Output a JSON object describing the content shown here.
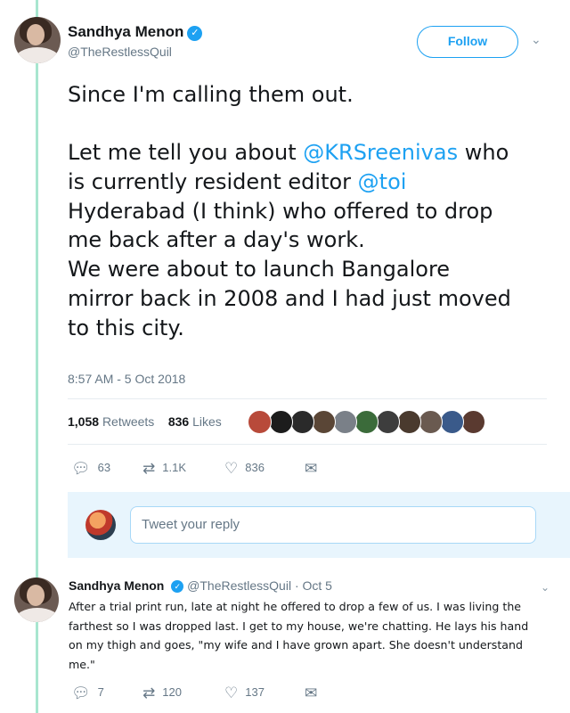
{
  "tweet": {
    "author_name": "Sandhya Menon",
    "author_handle": "@TheRestlessQuil",
    "follow_label": "Follow",
    "text_lines": [
      [
        {
          "t": "Since I'm calling them out.",
          "m": false
        }
      ],
      [
        {
          "t": "",
          "m": false
        }
      ],
      [
        {
          "t": "Let me tell you about ",
          "m": false
        },
        {
          "t": "@KRSreenivas",
          "m": true
        },
        {
          "t": " who",
          "m": false
        }
      ],
      [
        {
          "t": "is currently resident editor ",
          "m": false
        },
        {
          "t": "@toi",
          "m": true
        }
      ],
      [
        {
          "t": "Hyderabad (I think) who offered to drop",
          "m": false
        }
      ],
      [
        {
          "t": "me back after a day's work.",
          "m": false
        }
      ],
      [
        {
          "t": "We were about to launch Bangalore",
          "m": false
        }
      ],
      [
        {
          "t": "mirror back in 2008 and I had just moved",
          "m": false
        }
      ],
      [
        {
          "t": "to this city.",
          "m": false
        }
      ]
    ],
    "timestamp": "8:57 AM - 5 Oct 2018",
    "retweets_count": "1,058",
    "retweets_label": "Retweets",
    "likes_count": "836",
    "likes_label": "Likes",
    "liker_colors": [
      "#b84a3a",
      "#1c1c1c",
      "#2a2a2a",
      "#5a4636",
      "#7a8088",
      "#3b6b3a",
      "#3d3d3d",
      "#4a3a2e",
      "#6a5a50",
      "#3a5a8a",
      "#5a3a30"
    ],
    "actions": {
      "replies": "63",
      "retweets": "1.1K",
      "likes": "836"
    }
  },
  "reply_box": {
    "placeholder": "Tweet your reply"
  },
  "reply": {
    "author_name": "Sandhya Menon",
    "author_handle": "@TheRestlessQuil",
    "date": "Oct 5",
    "text_lines": [
      "After a trial print run, late at night he offered to drop a few of us. I was living the",
      "farthest so I was dropped last. I get to my house, we're chatting. He lays his hand",
      "on my thigh and goes, \"my wife and I have grown apart. She doesn't understand",
      "me.\""
    ],
    "actions": {
      "replies": "7",
      "retweets": "120",
      "likes": "137"
    }
  },
  "colors": {
    "accent": "#1da1f2",
    "thread_line": "#a8e6cf",
    "muted": "#657786"
  },
  "icons": {
    "reply": "reply-icon",
    "retweet": "retweet-icon",
    "like": "heart-icon",
    "dm": "envelope-icon",
    "verified": "verified-badge-icon",
    "more": "chevron-down-icon"
  }
}
